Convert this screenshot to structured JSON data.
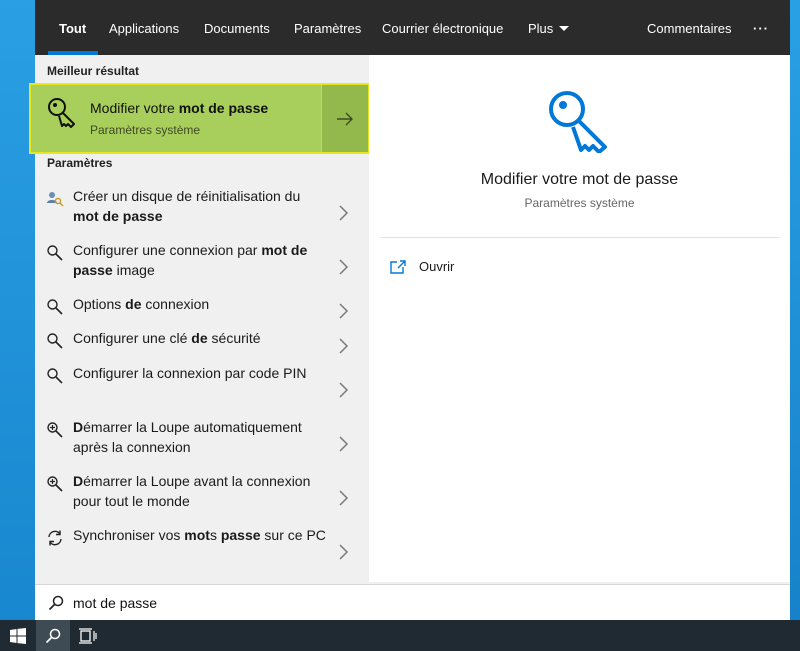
{
  "tabs": [
    {
      "label": "Tout",
      "active": true
    },
    {
      "label": "Applications"
    },
    {
      "label": "Documents"
    },
    {
      "label": "Paramètres"
    },
    {
      "label": "Courrier électronique"
    },
    {
      "label": "Plus"
    }
  ],
  "feedback_label": "Commentaires",
  "more_options_label": "···",
  "best_match": {
    "section_label": "Meilleur résultat",
    "title_prefix": "Modifier votre ",
    "title_bold": "mot de passe",
    "subtitle": "Paramètres système",
    "icon": "key-icon",
    "arrow_icon": "arrow-right-icon"
  },
  "settings_section_label": "Paramètres",
  "results": [
    {
      "icon": "user-key-icon",
      "parts": [
        {
          "t": "Créer un disque de réinitialisation du "
        },
        {
          "t": "mot de passe",
          "b": true
        }
      ]
    },
    {
      "icon": "search-settings-icon",
      "parts": [
        {
          "t": "Configurer une connexion par "
        },
        {
          "t": "mot de passe",
          "b": true
        },
        {
          "t": " image"
        }
      ]
    },
    {
      "icon": "search-settings-icon",
      "parts": [
        {
          "t": "Options "
        },
        {
          "t": "de",
          "b": true
        },
        {
          "t": " connexion"
        }
      ]
    },
    {
      "icon": "search-settings-icon",
      "parts": [
        {
          "t": "Configurer une clé "
        },
        {
          "t": "de",
          "b": true
        },
        {
          "t": " sécurité"
        }
      ]
    },
    {
      "icon": "search-settings-icon",
      "parts": [
        {
          "t": "Configurer la connexion par code PIN"
        }
      ]
    },
    {
      "icon": "magnifier-plus-icon",
      "parts": [
        {
          "t": "D",
          "b": true
        },
        {
          "t": "émarrer la Loupe automatiquement après la connexion"
        }
      ]
    },
    {
      "icon": "magnifier-plus-icon",
      "parts": [
        {
          "t": "D",
          "b": true
        },
        {
          "t": "émarrer la Loupe avant la connexion pour tout le monde"
        }
      ]
    },
    {
      "icon": "sync-icon",
      "parts": [
        {
          "t": "Synchroniser vos "
        },
        {
          "t": "mot",
          "b": true
        },
        {
          "t": "s "
        },
        {
          "t": "passe",
          "b": true
        },
        {
          "t": " sur ce PC"
        }
      ]
    }
  ],
  "preview": {
    "title": "Modifier votre mot de passe",
    "subtitle": "Paramètres système",
    "open_label": "Ouvrir",
    "icon": "key-icon"
  },
  "search": {
    "value": "mot de passe",
    "icon": "search-icon"
  },
  "taskbar": {
    "icons": [
      "windows-start-icon",
      "search-icon",
      "task-view-icon"
    ]
  },
  "colors": {
    "accent": "#0078d7",
    "highlight": "#a8ce5c",
    "highlight_border": "#e8e61e",
    "topbar": "#2b2b2b"
  }
}
